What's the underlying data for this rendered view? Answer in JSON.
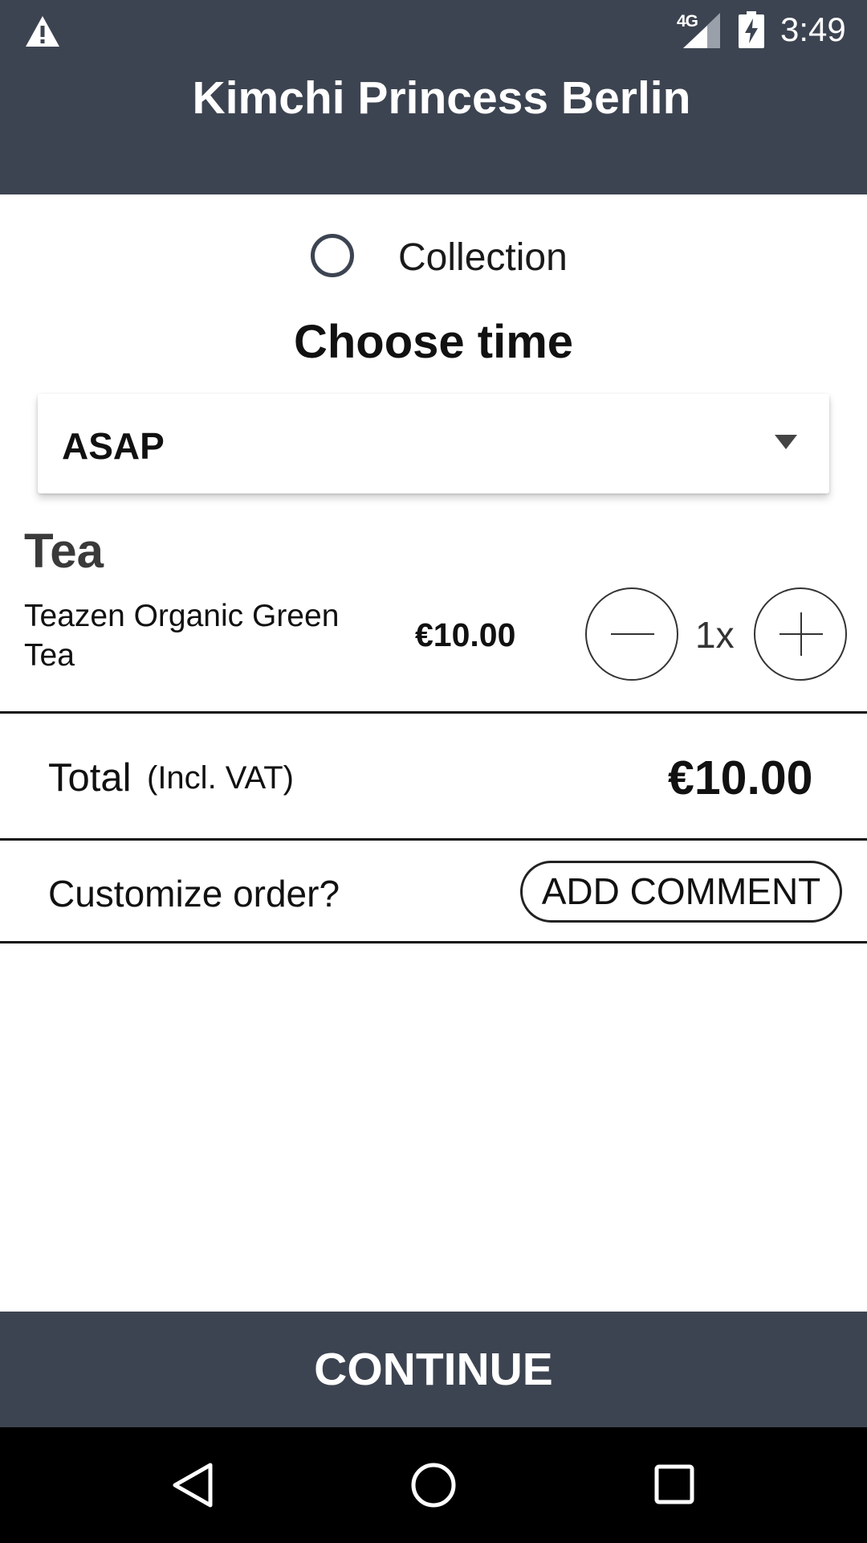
{
  "status_bar": {
    "network_type": "4G",
    "time": "3:49",
    "icons": [
      "warning-icon",
      "signal-icon",
      "battery-charging-icon"
    ]
  },
  "header": {
    "title": "Kimchi Princess Berlin"
  },
  "delivery": {
    "option_label": "Collection",
    "option_selected": false
  },
  "time_picker": {
    "heading": "Choose time",
    "selected_value": "ASAP"
  },
  "cart": {
    "category": "Tea",
    "items": [
      {
        "name": "Teazen Organic Green Tea",
        "price": "€10.00",
        "quantity": "1x"
      }
    ]
  },
  "total": {
    "label": "Total",
    "note": "(Incl. VAT)",
    "value": "€10.00"
  },
  "customize": {
    "label": "Customize order?",
    "button_label": "ADD COMMENT"
  },
  "footer": {
    "continue_label": "CONTINUE"
  },
  "nav_bar": {
    "buttons": [
      "back-icon",
      "home-icon",
      "recents-icon"
    ]
  },
  "colors": {
    "primary": "#3d4451",
    "background": "#ffffff",
    "nav_bar": "#000000"
  }
}
